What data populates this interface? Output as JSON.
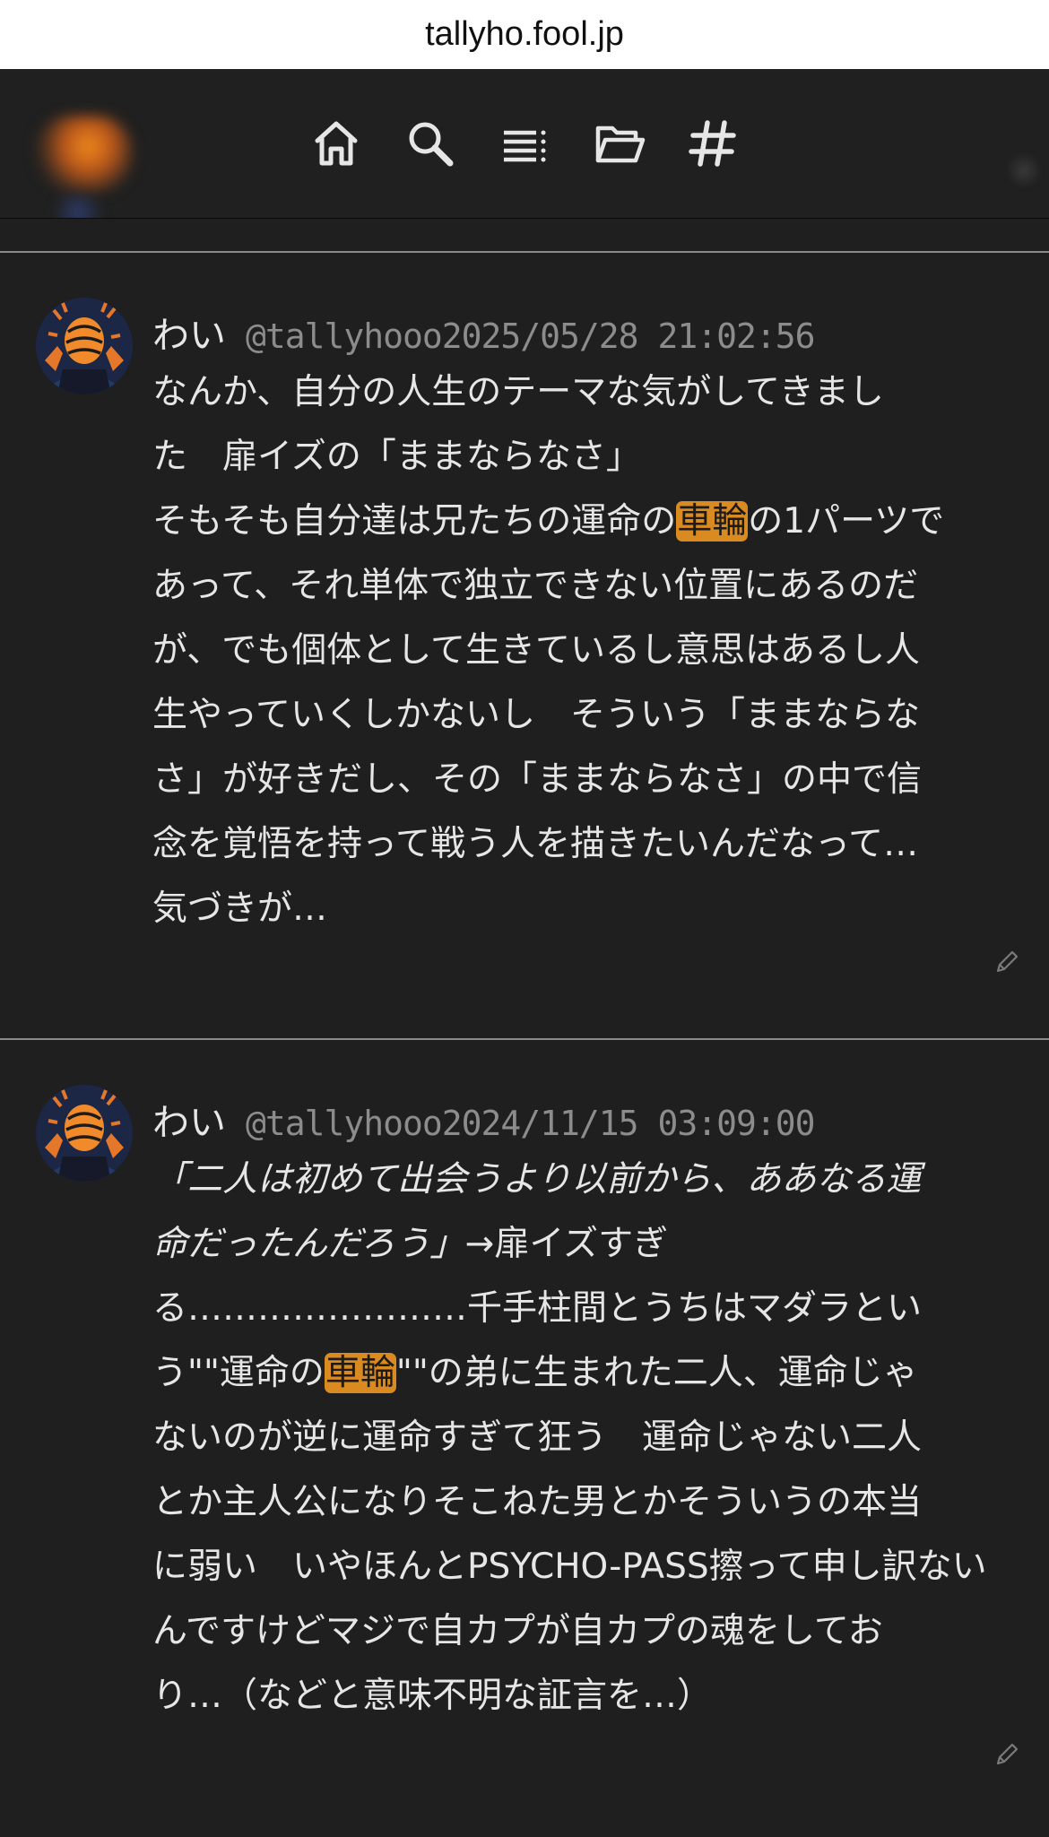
{
  "browser": {
    "url": "tallyho.fool.jp"
  },
  "nav": {
    "icons": [
      "home-icon",
      "search-icon",
      "list-icon",
      "folder-icon",
      "hashtag-icon"
    ]
  },
  "posts": [
    {
      "author": "わい",
      "handle": "@tallyhooo",
      "timestamp": "2025/05/28 21:02:56",
      "highlight": "車輪",
      "lines": {
        "l1": "なんか、自分の人生のテーマな気がしてきまし",
        "l2": "た　扉イズの「ままならなさ」",
        "l3a": "そもそも自分達は兄たちの運命の",
        "l3b": "の1パーツで",
        "l4": "あって、それ単体で独立できない位置にあるのだ",
        "l5": "が、でも個体として生きているし意思はあるし人",
        "l6": "生やっていくしかないし　そういう「ままならな",
        "l7": "さ」が好きだし、その「ままならなさ」の中で信",
        "l8": "念を覚悟を持って戦う人を描きたいんだなって…",
        "l9": "気づきが…"
      }
    },
    {
      "author": "わい",
      "handle": "@tallyhooo",
      "timestamp": "2024/11/15 03:09:00",
      "highlight": "車輪",
      "lines": {
        "l1": "「二人は初めて出会うより以前から、ああなる運",
        "l2a": "命だったんだろう」",
        "l2b": "→扉イズすぎ",
        "l3": "る……………………千手柱間とうちはマダラとい",
        "l4a": "う\"\"運命の",
        "l4b": "\"\"の弟に生まれた二人、運命じゃ",
        "l5": "ないのが逆に運命すぎて狂う　運命じゃない二人",
        "l6": "とか主人公になりそこねた男とかそういうの本当",
        "l7": "に弱い　いやほんとPSYCHO-PASS擦って申し訳ない",
        "l8": "んですけどマジで自カプが自カプの魂をしてお",
        "l9": "り…（などと意味不明な証言を…）"
      }
    }
  ],
  "colors": {
    "background": "#1f1f1f",
    "highlight": "#d98a20",
    "meta": "#8c8c8c",
    "divider": "#8a8a8a"
  }
}
